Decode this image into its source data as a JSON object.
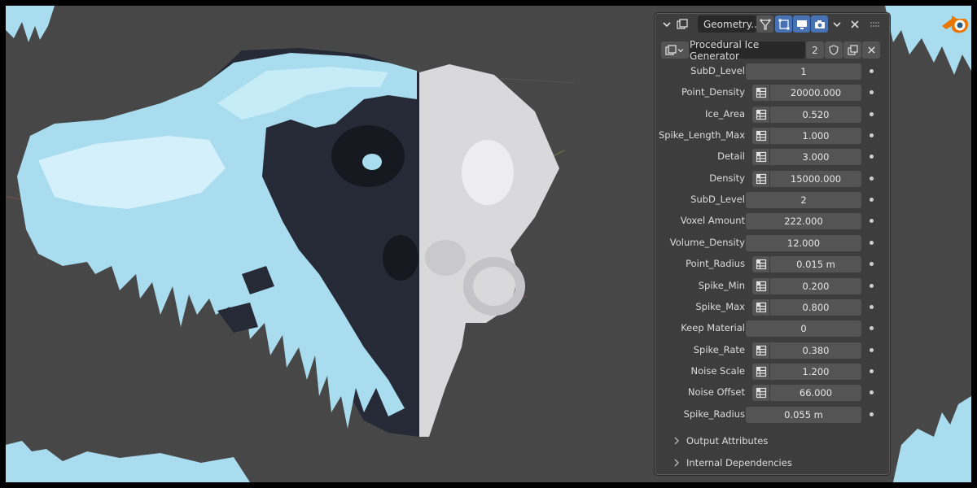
{
  "editor": {
    "panel_title": "Geometry...",
    "node_group_name": "Procedural Ice Generator",
    "user_count": "2"
  },
  "icons": {
    "collapse": "chevron-down-icon",
    "editor_type": "properties-icon",
    "filter": "geometry-nodes-funnel-icon",
    "vertex_select": "vertex-select-icon",
    "viewport_display": "monitor-icon",
    "render": "camera-icon",
    "dropdown": "chevron-down-icon",
    "close": "close-icon",
    "drag": "drag-handle-icon",
    "fake_user": "shield-icon",
    "duplicate": "duplicate-icon",
    "unlink": "close-icon",
    "app_logo": "blender-logo",
    "attribute_toggle": "attribute-table-icon",
    "decorator": "keyframe-dot-icon",
    "section_expand": "chevron-right-icon"
  },
  "inputs": [
    {
      "label": "SubD_Level",
      "value": "1",
      "attribute_toggle": false
    },
    {
      "label": "Point_Density",
      "value": "20000.000",
      "attribute_toggle": true
    },
    {
      "label": "Ice_Area",
      "value": "0.520",
      "attribute_toggle": true
    },
    {
      "label": "Spike_Length_Max",
      "value": "1.000",
      "attribute_toggle": true
    },
    {
      "label": "Detail",
      "value": "3.000",
      "attribute_toggle": true
    },
    {
      "label": "Density",
      "value": "15000.000",
      "attribute_toggle": true
    },
    {
      "label": "SubD_Level",
      "value": "2",
      "attribute_toggle": false
    },
    {
      "label": "Voxel Amount",
      "value": "222.000",
      "attribute_toggle": false
    },
    {
      "label": "Volume_Density",
      "value": "12.000",
      "attribute_toggle": false
    },
    {
      "label": "Point_Radius",
      "value": "0.015 m",
      "attribute_toggle": true
    },
    {
      "label": "Spike_Min",
      "value": "0.200",
      "attribute_toggle": true
    },
    {
      "label": "Spike_Max",
      "value": "0.800",
      "attribute_toggle": true
    },
    {
      "label": "Keep Material",
      "value": "0",
      "attribute_toggle": false
    },
    {
      "label": "Spike_Rate",
      "value": "0.380",
      "attribute_toggle": true
    },
    {
      "label": "Noise Scale",
      "value": "1.200",
      "attribute_toggle": true
    },
    {
      "label": "Noise Offset",
      "value": "66.000",
      "attribute_toggle": true
    },
    {
      "label": "Spike_Radius",
      "value": "0.055 m",
      "attribute_toggle": false
    }
  ],
  "sections": [
    {
      "label": "Output Attributes"
    },
    {
      "label": "Internal Dependencies"
    }
  ],
  "colors": {
    "panel_bg": "#3d3d3d",
    "field_bg": "#545454",
    "header_field_bg": "#282828",
    "accent_blue": "#4772b3",
    "viewport_bg": "#474747",
    "ice": "#a9dcee",
    "ice_light": "#d4f1fb",
    "monkey_dark": "#252a36",
    "monkey_light": "#d9d9dc",
    "blender_orange": "#ea7600",
    "blender_blue": "#265787"
  }
}
